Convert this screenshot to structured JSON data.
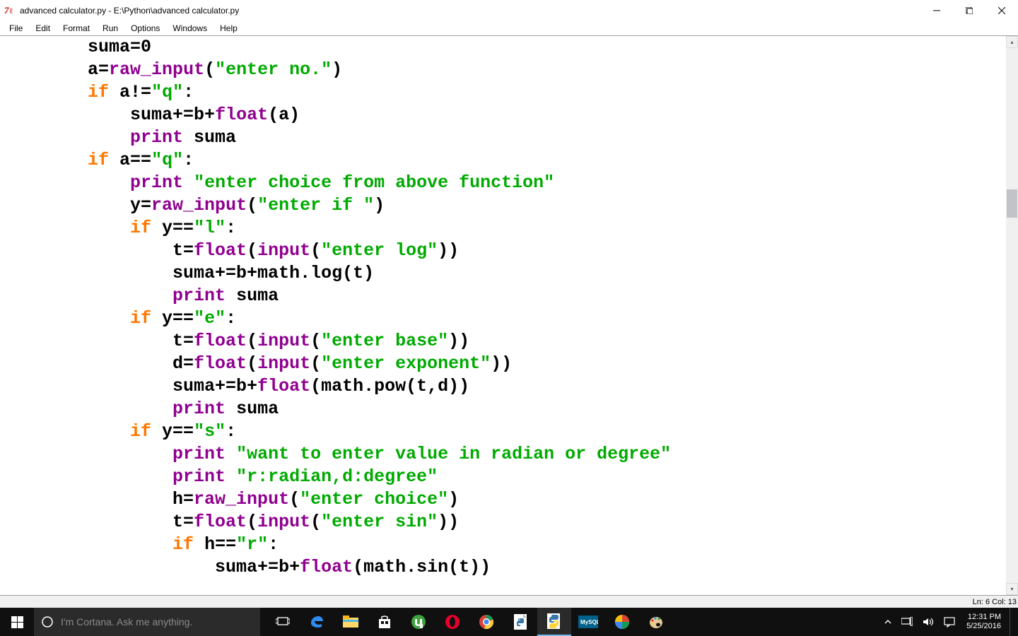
{
  "window": {
    "title": "advanced calculator.py - E:\\Python\\advanced calculator.py"
  },
  "menu": {
    "items": [
      "File",
      "Edit",
      "Format",
      "Run",
      "Options",
      "Windows",
      "Help"
    ]
  },
  "code": {
    "lines": [
      [
        {
          "t": "        suma",
          "c": "plain"
        },
        {
          "t": "=",
          "c": "plain"
        },
        {
          "t": "0",
          "c": "plain"
        }
      ],
      [
        {
          "t": "        a",
          "c": "plain"
        },
        {
          "t": "=",
          "c": "plain"
        },
        {
          "t": "raw_input",
          "c": "bi"
        },
        {
          "t": "(",
          "c": "plain"
        },
        {
          "t": "\"enter no.\"",
          "c": "str"
        },
        {
          "t": ")",
          "c": "plain"
        }
      ],
      [
        {
          "t": "        ",
          "c": "plain"
        },
        {
          "t": "if",
          "c": "kw"
        },
        {
          "t": " a!=",
          "c": "plain"
        },
        {
          "t": "\"q\"",
          "c": "str"
        },
        {
          "t": ":",
          "c": "plain"
        }
      ],
      [
        {
          "t": "            suma+=b+",
          "c": "plain"
        },
        {
          "t": "float",
          "c": "bi"
        },
        {
          "t": "(a)",
          "c": "plain"
        }
      ],
      [
        {
          "t": "            ",
          "c": "plain"
        },
        {
          "t": "print",
          "c": "bi"
        },
        {
          "t": " suma",
          "c": "plain"
        }
      ],
      [
        {
          "t": "        ",
          "c": "plain"
        },
        {
          "t": "if",
          "c": "kw"
        },
        {
          "t": " a==",
          "c": "plain"
        },
        {
          "t": "\"q\"",
          "c": "str"
        },
        {
          "t": ":",
          "c": "plain"
        }
      ],
      [
        {
          "t": "            ",
          "c": "plain"
        },
        {
          "t": "print",
          "c": "bi"
        },
        {
          "t": " ",
          "c": "plain"
        },
        {
          "t": "\"enter choice from above function\"",
          "c": "str"
        }
      ],
      [
        {
          "t": "            y=",
          "c": "plain"
        },
        {
          "t": "raw_input",
          "c": "bi"
        },
        {
          "t": "(",
          "c": "plain"
        },
        {
          "t": "\"enter if \"",
          "c": "str"
        },
        {
          "t": ")",
          "c": "plain"
        }
      ],
      [
        {
          "t": "            ",
          "c": "plain"
        },
        {
          "t": "if",
          "c": "kw"
        },
        {
          "t": " y==",
          "c": "plain"
        },
        {
          "t": "\"l\"",
          "c": "str"
        },
        {
          "t": ":",
          "c": "plain"
        }
      ],
      [
        {
          "t": "                t=",
          "c": "plain"
        },
        {
          "t": "float",
          "c": "bi"
        },
        {
          "t": "(",
          "c": "plain"
        },
        {
          "t": "input",
          "c": "bi"
        },
        {
          "t": "(",
          "c": "plain"
        },
        {
          "t": "\"enter log\"",
          "c": "str"
        },
        {
          "t": "))",
          "c": "plain"
        }
      ],
      [
        {
          "t": "                suma+=b+math.log(t)",
          "c": "plain"
        }
      ],
      [
        {
          "t": "                ",
          "c": "plain"
        },
        {
          "t": "print",
          "c": "bi"
        },
        {
          "t": " suma",
          "c": "plain"
        }
      ],
      [
        {
          "t": "            ",
          "c": "plain"
        },
        {
          "t": "if",
          "c": "kw"
        },
        {
          "t": " y==",
          "c": "plain"
        },
        {
          "t": "\"e\"",
          "c": "str"
        },
        {
          "t": ":",
          "c": "plain"
        }
      ],
      [
        {
          "t": "                t=",
          "c": "plain"
        },
        {
          "t": "float",
          "c": "bi"
        },
        {
          "t": "(",
          "c": "plain"
        },
        {
          "t": "input",
          "c": "bi"
        },
        {
          "t": "(",
          "c": "plain"
        },
        {
          "t": "\"enter base\"",
          "c": "str"
        },
        {
          "t": "))",
          "c": "plain"
        }
      ],
      [
        {
          "t": "                d=",
          "c": "plain"
        },
        {
          "t": "float",
          "c": "bi"
        },
        {
          "t": "(",
          "c": "plain"
        },
        {
          "t": "input",
          "c": "bi"
        },
        {
          "t": "(",
          "c": "plain"
        },
        {
          "t": "\"enter exponent\"",
          "c": "str"
        },
        {
          "t": "))",
          "c": "plain"
        }
      ],
      [
        {
          "t": "                suma+=b+",
          "c": "plain"
        },
        {
          "t": "float",
          "c": "bi"
        },
        {
          "t": "(math.pow(t,d))",
          "c": "plain"
        }
      ],
      [
        {
          "t": "                ",
          "c": "plain"
        },
        {
          "t": "print",
          "c": "bi"
        },
        {
          "t": " suma",
          "c": "plain"
        }
      ],
      [
        {
          "t": "            ",
          "c": "plain"
        },
        {
          "t": "if",
          "c": "kw"
        },
        {
          "t": " y==",
          "c": "plain"
        },
        {
          "t": "\"s\"",
          "c": "str"
        },
        {
          "t": ":",
          "c": "plain"
        }
      ],
      [
        {
          "t": "                ",
          "c": "plain"
        },
        {
          "t": "print",
          "c": "bi"
        },
        {
          "t": " ",
          "c": "plain"
        },
        {
          "t": "\"want to enter value in radian or degree\"",
          "c": "str"
        }
      ],
      [
        {
          "t": "                ",
          "c": "plain"
        },
        {
          "t": "print",
          "c": "bi"
        },
        {
          "t": " ",
          "c": "plain"
        },
        {
          "t": "\"r:radian,d:degree\"",
          "c": "str"
        }
      ],
      [
        {
          "t": "                h=",
          "c": "plain"
        },
        {
          "t": "raw_input",
          "c": "bi"
        },
        {
          "t": "(",
          "c": "plain"
        },
        {
          "t": "\"enter choice\"",
          "c": "str"
        },
        {
          "t": ")",
          "c": "plain"
        }
      ],
      [
        {
          "t": "                t=",
          "c": "plain"
        },
        {
          "t": "float",
          "c": "bi"
        },
        {
          "t": "(",
          "c": "plain"
        },
        {
          "t": "input",
          "c": "bi"
        },
        {
          "t": "(",
          "c": "plain"
        },
        {
          "t": "\"enter sin\"",
          "c": "str"
        },
        {
          "t": "))",
          "c": "plain"
        }
      ],
      [
        {
          "t": "                ",
          "c": "plain"
        },
        {
          "t": "if",
          "c": "kw"
        },
        {
          "t": " h==",
          "c": "plain"
        },
        {
          "t": "\"r\"",
          "c": "str"
        },
        {
          "t": ":",
          "c": "plain"
        }
      ],
      [
        {
          "t": "                    suma+=b+",
          "c": "plain"
        },
        {
          "t": "float",
          "c": "bi"
        },
        {
          "t": "(math.sin(t))",
          "c": "plain"
        }
      ]
    ]
  },
  "status": {
    "text": "Ln: 6 Col: 13"
  },
  "taskbar": {
    "cortana_placeholder": "I'm Cortana. Ask me anything.",
    "clock_time": "12:31 PM",
    "clock_date": "5/25/2016"
  }
}
